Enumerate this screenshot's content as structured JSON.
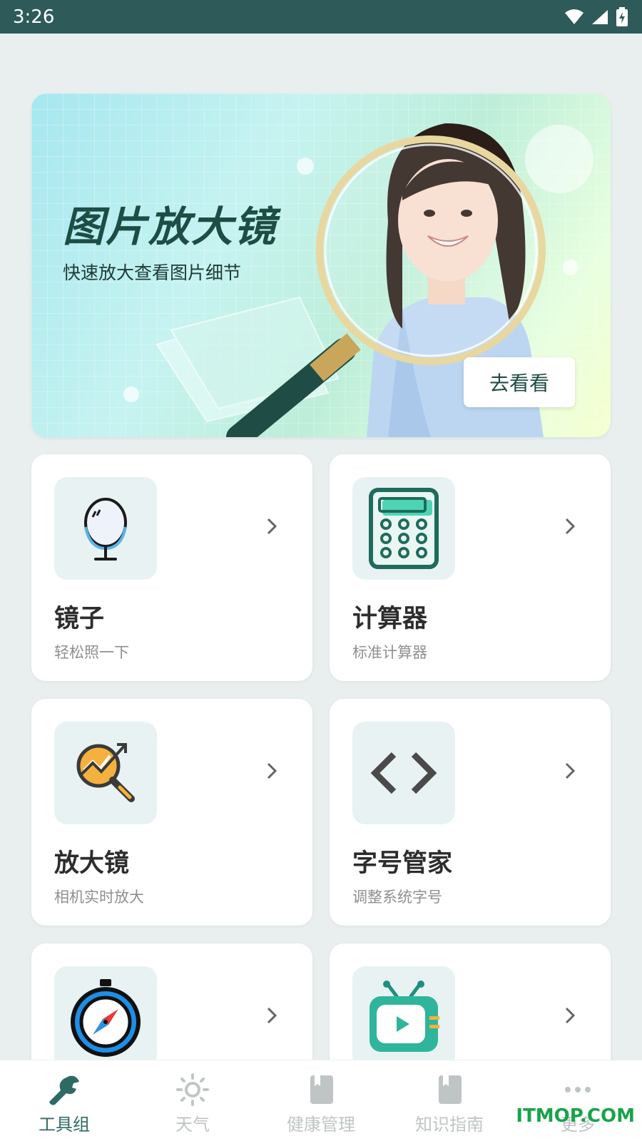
{
  "status_bar": {
    "time": "3:26"
  },
  "banner": {
    "title": "图片放大镜",
    "subtitle": "快速放大查看图片细节",
    "button_label": "去看看"
  },
  "tools": [
    {
      "title": "镜子",
      "subtitle": "轻松照一下",
      "icon": "mirror-icon"
    },
    {
      "title": "计算器",
      "subtitle": "标准计算器",
      "icon": "calculator-icon"
    },
    {
      "title": "放大镜",
      "subtitle": "相机实时放大",
      "icon": "magnifier-chart-icon"
    },
    {
      "title": "字号管家",
      "subtitle": "调整系统字号",
      "icon": "code-brackets-icon"
    },
    {
      "title": "",
      "subtitle": "",
      "icon": "compass-icon"
    },
    {
      "title": "",
      "subtitle": "",
      "icon": "tv-play-icon"
    }
  ],
  "tab_bar": {
    "tabs": [
      {
        "label": "工具组",
        "icon": "wrench-icon",
        "active": true
      },
      {
        "label": "天气",
        "icon": "sun-icon",
        "active": false
      },
      {
        "label": "健康管理",
        "icon": "book-icon",
        "active": false
      },
      {
        "label": "知识指南",
        "icon": "book-icon",
        "active": false
      },
      {
        "label": "更多",
        "icon": "more-dots-icon",
        "active": false
      }
    ]
  },
  "watermark": "ITMOP.COM",
  "colors": {
    "status_bar": "#2f5a5a",
    "background": "#e8efee",
    "accent": "#2e6a64",
    "tab_inactive": "#bfc5c5"
  }
}
